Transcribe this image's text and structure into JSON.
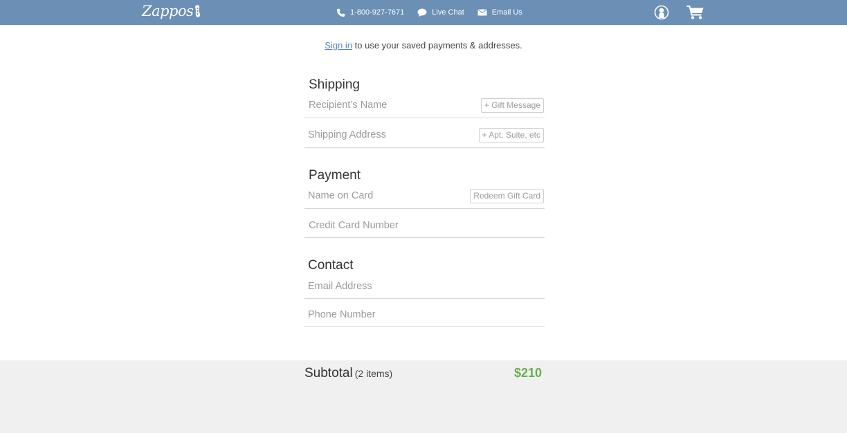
{
  "header": {
    "logo_text": "Zappos",
    "phone": "1-800-927-7671",
    "live_chat": "Live Chat",
    "email_us": "Email Us"
  },
  "signin": {
    "link": "Sign in",
    "text": " to use your saved payments & addresses."
  },
  "shipping": {
    "title": "Shipping",
    "recipient_placeholder": "Recipient’s Name",
    "gift_message": "+ Gift Message",
    "address_placeholder": "Shipping Address",
    "apt_suite": "+ Apt, Suite, etc"
  },
  "payment": {
    "title": "Payment",
    "name_on_card_placeholder": "Name on Card",
    "redeem_gift_card": "Redeem Gift Card",
    "card_number_placeholder": "Credit Card Number"
  },
  "contact": {
    "title": "Contact",
    "email_placeholder": "Email Address",
    "phone_placeholder": "Phone Number"
  },
  "summary": {
    "subtotal_label": "Subtotal",
    "item_count": "(2 items)",
    "price": "$210"
  },
  "colors": {
    "header_bg": "#6b8fb5",
    "link": "#5b86b8",
    "price": "#67b04a",
    "summary_bg": "#f0f0f0"
  }
}
